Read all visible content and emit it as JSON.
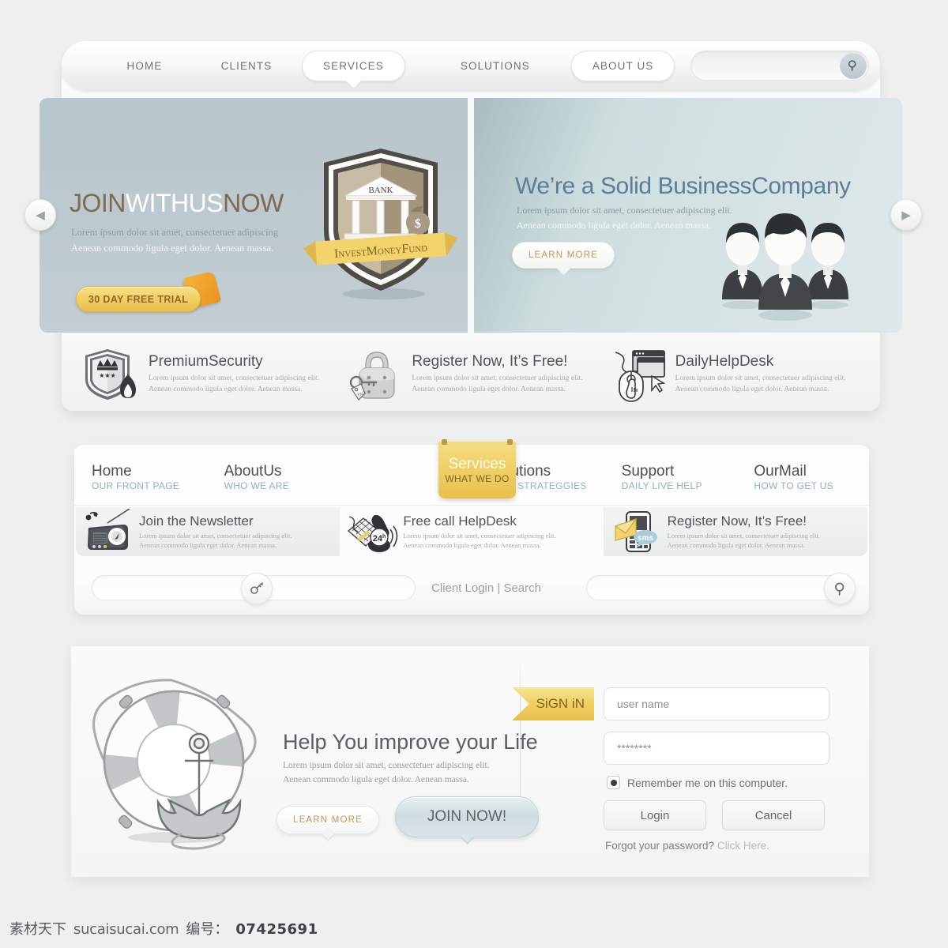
{
  "header": {
    "nav": [
      {
        "label": "HOME",
        "style": "plain"
      },
      {
        "label": "CLIENTS",
        "style": "plain"
      },
      {
        "label": "SERVICES",
        "style": "pill-active"
      },
      {
        "label": "SOLUTIONS",
        "style": "plain"
      },
      {
        "label": "ABOUT US",
        "style": "pill"
      }
    ],
    "search": {
      "value": "",
      "placeholder": "",
      "icon": "search-icon"
    }
  },
  "hero": {
    "prev_arrow": "◀",
    "next_arrow": "▶",
    "left": {
      "title_part1": "JOIN",
      "title_part2": "WITHUS",
      "title_part3": "NOW",
      "sub_line1": "Lorem ipsum dolor sit amet, consectetuer adipiscing",
      "sub_line2": "Aenean commodo ligula eget dolor. Aenean massa.",
      "button": "30 DAY FREE TRIAL",
      "badge_bank": "BANK",
      "badge_ribbon": "InvestMoneyFund"
    },
    "right": {
      "title": "We’re a Solid BusinessCompany",
      "sub_line1": "Lorem ipsum dolor sit amet, consectetuer adipiscing elit.",
      "sub_line2": "Aenean commodo ligula eget dolor. Aenean massa.",
      "button": "LEARN MORE"
    }
  },
  "features": [
    {
      "icon": "shield-crown-flame-icon",
      "title": "PremiumSecurity",
      "line1": "Lorem ipsum dolor sit amet, consectetuer adipiscing elit.",
      "line2": "Aenean commodo ligula eget dolor. Aenean massa."
    },
    {
      "icon": "padlock-key-tag-icon",
      "title": "Register Now, It’s Free!",
      "line1": "Lorem ipsum dolor sit amet, consectetuer adipiscing elit.",
      "line2": "Aenean commodo ligula eget dolor. Aenean massa."
    },
    {
      "icon": "mouse-cursor-window-icon",
      "title": "DailyHelpDesk",
      "line1": "Lorem ipsum dolor sit amet, consectetuer adipiscing elit.",
      "line2": "Aenean commodo ligula eget dolor. Aenean massa."
    }
  ],
  "secondary_nav": [
    {
      "title": "Home",
      "subtitle": "OUR FRONT PAGE",
      "active": false
    },
    {
      "title": "AboutUs",
      "subtitle": "WHO WE ARE",
      "active": false
    },
    {
      "title": "Services",
      "subtitle": "WHAT WE DO",
      "active": true
    },
    {
      "title": "Solutions",
      "subtitle": "BEST STRATEGGIES",
      "active": false
    },
    {
      "title": "Support",
      "subtitle": "DAILY LIVE HELP",
      "active": false
    },
    {
      "title": "OurMail",
      "subtitle": "HOW TO GET US",
      "active": false
    }
  ],
  "services": [
    {
      "icon": "radio-music-icon",
      "title": "Join the Newsletter",
      "line1": "Lorem ipsum dolor sit amet, consectetuer adipiscing elit.",
      "line2": "Aenean commodo ligula eget dolor. Aenean massa."
    },
    {
      "icon": "keyboard-phone-24h-icon",
      "title": "Free call HelpDesk",
      "badge": "24",
      "badge_sup": "h",
      "line1": "Lorem ipsum dolor sit amet, consectetuer adipiscing elit.",
      "line2": "Aenean commodo ligula eget dolor. Aenean massa."
    },
    {
      "icon": "mobile-sms-envelope-icon",
      "title": "Register Now, It’s Free!",
      "badge": "sms",
      "line1": "Lorem ipsum dolor sit amet, consectetuer adipiscing elit.",
      "line2": "Aenean commodo ligula eget dolor. Aenean massa."
    }
  ],
  "sec_bottom": {
    "key_field_value": "",
    "key_field_placeholder": "",
    "key_icon": "key-icon",
    "label": "Client Login | Search",
    "search_field_value": "",
    "search_field_placeholder": "",
    "search_icon": "search-icon"
  },
  "bottom": {
    "buoy_icon": "lifebuoy-anchor-icon",
    "title": "Help You improve your Life",
    "sub_line1": "Lorem ipsum dolor sit amet, consectetuer adipiscing elit.",
    "sub_line2": "Aenean commodo ligula eget dolor. Aenean massa.",
    "learn_more": "LEARN MORE",
    "join_now": "JOIN NOW!",
    "signin_ribbon": "SiGN iN",
    "form": {
      "username_value": "user name",
      "username_placeholder": "user name",
      "password_value": "********",
      "password_placeholder": "********",
      "remember_label": "Remember me on this computer.",
      "remember_checked": true,
      "login_button": "Login",
      "cancel_button": "Cancel",
      "forgot_text": "Forgot your password?",
      "forgot_link": "Click Here."
    }
  },
  "watermark": {
    "site_cn": "素材天下",
    "domain": "sucaisucai.com",
    "id_label": "编号：",
    "id_value": "07425691"
  },
  "colors": {
    "page_bg": "#eef0f0",
    "hero_left_bg": "#bdcad0",
    "hero_right_bg": "#d6e3e5",
    "accent_yellow": "#f1d269",
    "accent_orange": "#e8941f",
    "link_blue": "#93b0c2",
    "heading_gray": "#4f5458",
    "learn_more_gold": "#c09a55"
  }
}
